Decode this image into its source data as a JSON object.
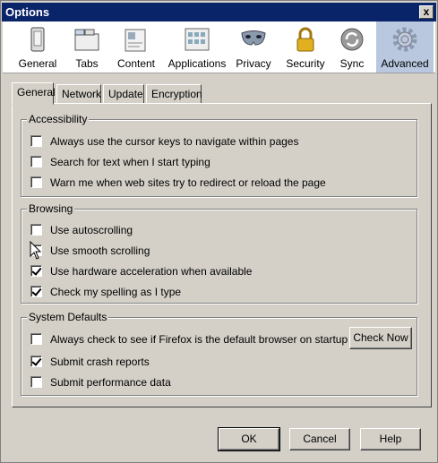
{
  "window": {
    "title": "Options",
    "close_label": "x"
  },
  "panes": [
    {
      "label": "General",
      "icon": "general-icon"
    },
    {
      "label": "Tabs",
      "icon": "tabs-icon"
    },
    {
      "label": "Content",
      "icon": "content-icon"
    },
    {
      "label": "Applications",
      "icon": "applications-icon"
    },
    {
      "label": "Privacy",
      "icon": "privacy-mask-icon"
    },
    {
      "label": "Security",
      "icon": "lock-icon"
    },
    {
      "label": "Sync",
      "icon": "sync-icon"
    },
    {
      "label": "Advanced",
      "icon": "gear-icon",
      "selected": true
    }
  ],
  "tabs": [
    {
      "label": "General",
      "active": true
    },
    {
      "label": "Network"
    },
    {
      "label": "Update"
    },
    {
      "label": "Encryption"
    }
  ],
  "accessibility": {
    "title": "Accessibility",
    "items": [
      {
        "label": "Always use the cursor keys to navigate within pages",
        "checked": false
      },
      {
        "label": "Search for text when I start typing",
        "checked": false
      },
      {
        "label": "Warn me when web sites try to redirect or reload the page",
        "checked": false
      }
    ]
  },
  "browsing": {
    "title": "Browsing",
    "items": [
      {
        "label": "Use autoscrolling",
        "checked": false
      },
      {
        "label": "Use smooth scrolling",
        "checked": false
      },
      {
        "label": "Use hardware acceleration when available",
        "checked": true
      },
      {
        "label": "Check my spelling as I type",
        "checked": true
      }
    ]
  },
  "system_defaults": {
    "title": "System Defaults",
    "items": [
      {
        "label": "Always check to see if Firefox is the default browser on startup",
        "checked": false
      },
      {
        "label": "Submit crash reports",
        "checked": true
      },
      {
        "label": "Submit performance data",
        "checked": false
      }
    ],
    "check_now_label": "Check Now"
  },
  "footer": {
    "ok_label": "OK",
    "cancel_label": "Cancel",
    "help_label": "Help"
  },
  "colors": {
    "title_bar": "#0a246a",
    "selected_pane": "#b9c7df",
    "dialog_bg": "#d4d0c8"
  }
}
